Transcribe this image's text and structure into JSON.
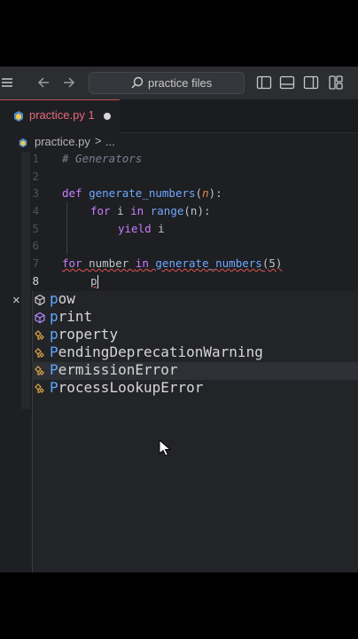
{
  "search": {
    "label": "practice files"
  },
  "tab": {
    "name": "practice.py",
    "badge": "1"
  },
  "breadcrumb": {
    "file": "practice.py",
    "sep": ">",
    "ellipsis": "..."
  },
  "lines": {
    "1": "1",
    "2": "2",
    "3": "3",
    "4": "4",
    "5": "5",
    "6": "6",
    "7": "7",
    "8": "8"
  },
  "code": {
    "l1": "# Generators",
    "l3_kw": "def",
    "l3_fn": "generate_numbers",
    "l3_open": "(",
    "l3_param": "n",
    "l3_close": "):",
    "l4_for": "for",
    "l4_i": " i ",
    "l4_in": "in",
    "l4_range": "range",
    "l4_rest": "(n):",
    "l5_yield": "yield",
    "l5_rest": " i",
    "l7_for": "for",
    "l7_var": " number ",
    "l7_in": "in",
    "l7_fn": "generate_numbers",
    "l7_rest": "(5)",
    "l8_typed": "p"
  },
  "suggest": {
    "close": "×",
    "items": [
      {
        "match": "p",
        "rest": "ow",
        "kind": "cube-icon"
      },
      {
        "match": "p",
        "rest": "rint",
        "kind": "cube-icon"
      },
      {
        "match": "p",
        "rest": "roperty",
        "kind": "class-icon"
      },
      {
        "match": "P",
        "rest": "endingDeprecationWarning",
        "kind": "class-icon"
      },
      {
        "match": "P",
        "rest": "ermissionError",
        "kind": "class-icon"
      },
      {
        "match": "P",
        "rest": "rocessLookupError",
        "kind": "class-icon"
      }
    ]
  }
}
